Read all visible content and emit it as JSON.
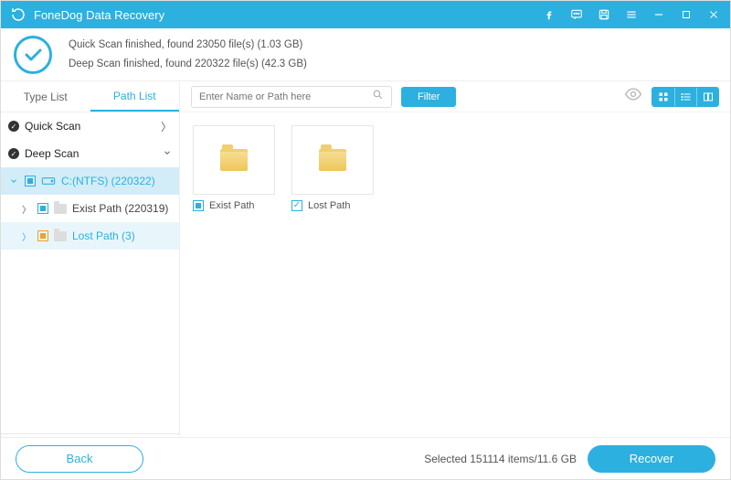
{
  "app": {
    "title": "FoneDog Data Recovery"
  },
  "status": {
    "line1": "Quick Scan finished, found 23050 file(s) (1.03 GB)",
    "line2": "Deep Scan finished, found 220322 file(s) (42.3 GB)"
  },
  "sidebar": {
    "tabs": {
      "type_list": "Type List",
      "path_list": "Path List"
    },
    "quick_scan": "Quick Scan",
    "deep_scan": "Deep Scan",
    "drive": "C:(NTFS) (220322)",
    "exist_path": "Exist Path (220319)",
    "lost_path": "Lost Path (3)"
  },
  "toolbar": {
    "search_placeholder": "Enter Name or Path here",
    "filter": "Filter"
  },
  "grid": {
    "items": [
      {
        "label": "Exist Path",
        "check_state": "filled"
      },
      {
        "label": "Lost Path",
        "check_state": "check"
      }
    ]
  },
  "footer": {
    "back": "Back",
    "recover": "Recover",
    "selected": "Selected 151114 items/11.6 GB"
  },
  "colors": {
    "accent": "#2cb0e0"
  }
}
